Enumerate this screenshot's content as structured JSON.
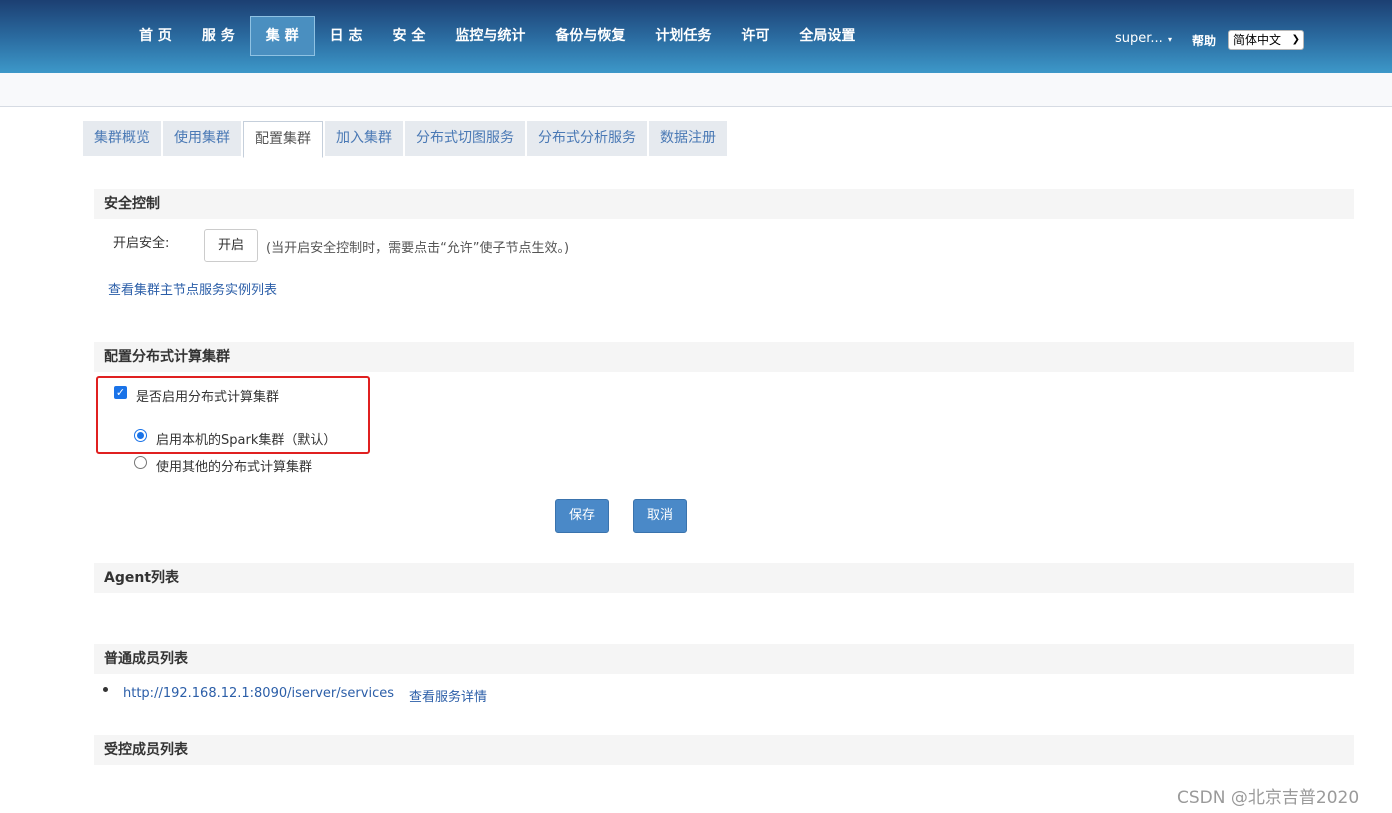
{
  "nav": {
    "items": [
      {
        "label": "首 页"
      },
      {
        "label": "服 务"
      },
      {
        "label": "集 群"
      },
      {
        "label": "日 志"
      },
      {
        "label": "安 全"
      },
      {
        "label": "监控与统计"
      },
      {
        "label": "备份与恢复"
      },
      {
        "label": "计划任务"
      },
      {
        "label": "许可"
      },
      {
        "label": "全局设置"
      }
    ],
    "active_index": 2,
    "user": "super...",
    "user_caret": "▾",
    "help": "帮助",
    "language": "简体中文"
  },
  "tabs": [
    {
      "label": "集群概览"
    },
    {
      "label": "使用集群"
    },
    {
      "label": "配置集群"
    },
    {
      "label": "加入集群"
    },
    {
      "label": "分布式切图服务"
    },
    {
      "label": "分布式分析服务"
    },
    {
      "label": "数据注册"
    }
  ],
  "active_tab_index": 2,
  "security": {
    "title": "安全控制",
    "enable_label": "开启安全:",
    "enable_button": "开启",
    "hint": "(当开启安全控制时，需要点击“允许”使子节点生效。)",
    "master_link": "查看集群主节点服务实例列表"
  },
  "distributed": {
    "title": "配置分布式计算集群",
    "enable_checkbox_label": "是否启用分布式计算集群",
    "enable_checked": true,
    "option_local": "启用本机的Spark集群（默认）",
    "option_other": "使用其他的分布式计算集群",
    "selected_option": "local",
    "save": "保存",
    "cancel": "取消"
  },
  "agent": {
    "title": "Agent列表"
  },
  "members": {
    "title": "普通成员列表",
    "items": [
      {
        "url": "http://192.168.12.1:8090/iserver/services",
        "detail": "查看服务详情"
      }
    ]
  },
  "controlled": {
    "title": "受控成员列表"
  },
  "watermark": "CSDN @北京吉普2020",
  "colors": {
    "accent": "#4a89c8",
    "link": "#2b5ea8",
    "highlight_box": "#e02020"
  }
}
